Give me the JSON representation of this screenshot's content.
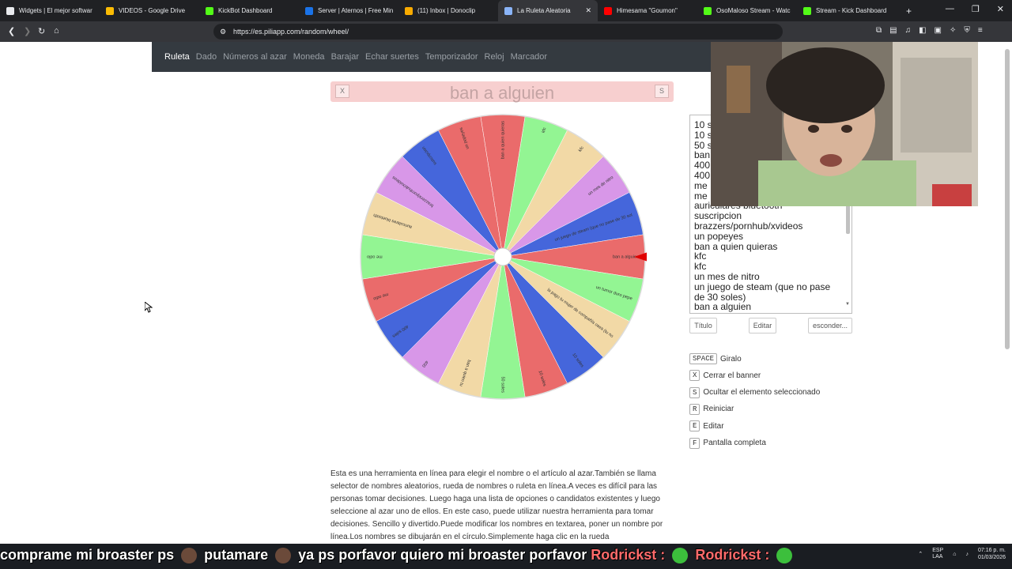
{
  "browser": {
    "tabs": [
      {
        "label": "Widgets | El mejor softwar",
        "color": "#e8eaed"
      },
      {
        "label": "VIDEOS - Google Drive",
        "color": "#fbbc04"
      },
      {
        "label": "KickBot Dashboard",
        "color": "#53fc18"
      },
      {
        "label": "Server | Aternos | Free Min",
        "color": "#1a73e8"
      },
      {
        "label": "(11) Inbox | Donoclip",
        "color": "#f9ab00"
      },
      {
        "label": "La Ruleta Aleatoria",
        "color": "#8ab4f8"
      },
      {
        "label": "Himesama \"Goumon\"",
        "color": "#ff0000"
      },
      {
        "label": "OsoMaloso Stream - Watc",
        "color": "#53fc18"
      },
      {
        "label": "Stream - Kick Dashboard",
        "color": "#53fc18"
      }
    ],
    "active_tab_close": "✕",
    "new_tab": "+",
    "url": "https://es.piliapp.com/random/wheel/"
  },
  "site_nav": {
    "items": [
      "Ruleta",
      "Dado",
      "Números al azar",
      "Moneda",
      "Barajar",
      "Echar suertes",
      "Temporizador",
      "Reloj",
      "Marcador"
    ],
    "active_index": 0
  },
  "banner": {
    "title": "ban a alguien",
    "close_label": "X",
    "hide_label": "S"
  },
  "wheel": {
    "segments": [
      {
        "label": "ban a quien quieras",
        "color": "#ea6b6b"
      },
      {
        "label": "kfc",
        "color": "#93f593"
      },
      {
        "label": "kfc",
        "color": "#f2d9a6"
      },
      {
        "label": "un mes de nitro",
        "color": "#d897e8"
      },
      {
        "label": "un juego de steam (que no pase de 30 soles)",
        "color": "#4566db"
      },
      {
        "label": "ban a alguien",
        "color": "#ea6b6b"
      },
      {
        "label": "un tumor duro pepe",
        "color": "#93f593"
      },
      {
        "label": "la pago tu mujer de compañía osea (tu novia)",
        "color": "#f2d9a6"
      },
      {
        "label": "10 soles",
        "color": "#4566db"
      },
      {
        "label": "10 soles",
        "color": "#ea6b6b"
      },
      {
        "label": "50 soles",
        "color": "#93f593"
      },
      {
        "label": "ban a quien tu",
        "color": "#f2d9a6"
      },
      {
        "label": "400",
        "color": "#d897e8"
      },
      {
        "label": "400 soles",
        "color": "#4566db"
      },
      {
        "label": "me odio",
        "color": "#ea6b6b"
      },
      {
        "label": "me odio",
        "color": "#93f593"
      },
      {
        "label": "auriculares bluetooth",
        "color": "#f2d9a6"
      },
      {
        "label": "brazzers/pornhub/xvideos",
        "color": "#d897e8"
      },
      {
        "label": "suscripcion",
        "color": "#4566db"
      },
      {
        "label": "un popeyes",
        "color": "#ea6b6b"
      }
    ]
  },
  "list": {
    "items": [
      "10 s",
      "10 s",
      "50 s",
      "ban",
      "400",
      "400",
      "me",
      "me",
      "auriculares bluetooth",
      "suscripcion",
      "brazzers/pornhub/xvideos",
      "un popeyes",
      "ban a quien quieras",
      "kfc",
      "kfc",
      "un mes de nitro",
      "un juego de steam (que no pase",
      "de 30 soles)",
      "ban a alguien"
    ]
  },
  "buttons": {
    "title": "Título",
    "edit": "Editar",
    "hide": "esconder..."
  },
  "shortcuts": [
    {
      "key": "SPACE",
      "label": "Giralo"
    },
    {
      "key": "X",
      "label": "Cerrar el banner"
    },
    {
      "key": "S",
      "label": "Ocultar el elemento seleccionado"
    },
    {
      "key": "R",
      "label": "Reiniciar"
    },
    {
      "key": "E",
      "label": "Editar"
    },
    {
      "key": "F",
      "label": "Pantalla completa"
    }
  ],
  "description": "Esta es una herramienta en línea para elegir el nombre o el artículo al azar.También se llama selector de nombres aleatorios, rueda de nombres o ruleta en línea.A veces es difícil para las personas tomar decisiones. Luego haga una lista de opciones o candidatos existentes y luego seleccione al azar uno de ellos. En este caso, puede utilizar nuestra herramienta para tomar decisiones. Sencillo y divertido.Puede modificar los nombres en textarea, poner un nombre por línea.Los nombres se dibujarán en el círculo.Simplemente haga clic en la rueda",
  "chat": {
    "message_1": "comprame mi broaster ps",
    "message_2": "putamare",
    "message_3": "ya ps porfavor quiero mi broaster porfavor",
    "user_1": "Rodrickst :",
    "user_2": "Rodrickst :"
  },
  "taskbar": {
    "lang": "ESP\nLAA",
    "time": "07:16 p. m.",
    "date": "01/03/2026"
  }
}
